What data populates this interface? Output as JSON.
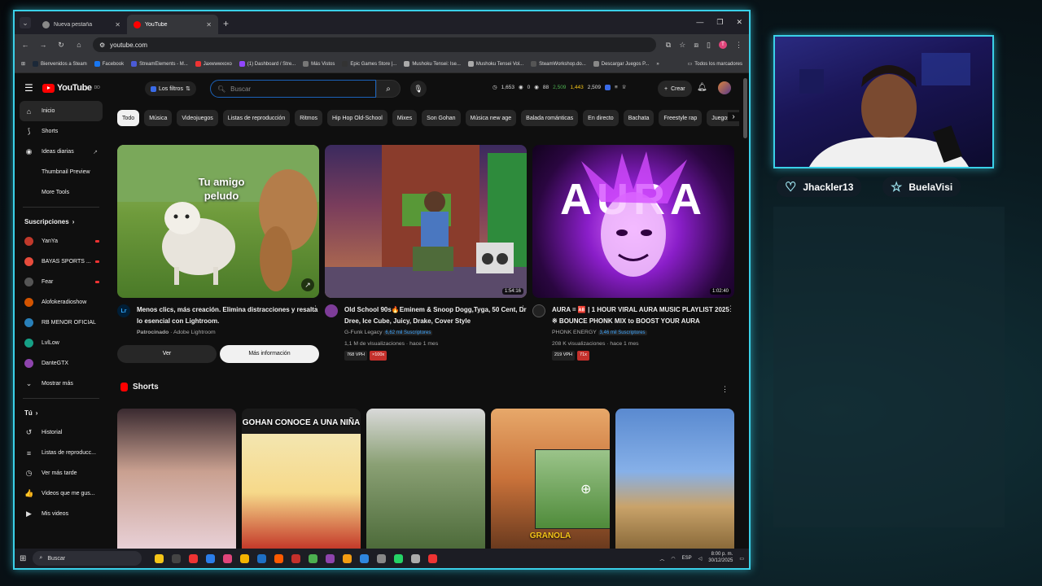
{
  "browser": {
    "tabs": [
      {
        "title": "Nueva pestaña",
        "active": false,
        "favicon_color": "#888888"
      },
      {
        "title": "YouTube",
        "active": true,
        "favicon_color": "#ff0000"
      }
    ],
    "address": "youtube.com",
    "bookmarks": [
      {
        "label": "Bienvenidos a Steam",
        "color": "#1b2838"
      },
      {
        "label": "Facebook",
        "color": "#1877f2"
      },
      {
        "label": "StreamElements - M...",
        "color": "#4b5bd6"
      },
      {
        "label": "Jaxwwwxoxo",
        "color": "#e33"
      },
      {
        "label": "(1) Dashboard / Stre...",
        "color": "#9146ff"
      },
      {
        "label": "Más Vistos",
        "color": "#777"
      },
      {
        "label": "Epic Games Store |...",
        "color": "#333"
      },
      {
        "label": "Mushoku Tensei: Ise...",
        "color": "#aaa"
      },
      {
        "label": "Mushoku Tensei Vol...",
        "color": "#aaa"
      },
      {
        "label": "SteamWorkshop.do...",
        "color": "#555"
      },
      {
        "label": "Descargar Juegos P...",
        "color": "#888"
      }
    ],
    "bookmarks_right": "Todos los marcadores"
  },
  "youtube": {
    "logo": "YouTube",
    "logo_region": "DO",
    "filters_label": "Los filtros",
    "search_placeholder": "Buscar",
    "stats": [
      "1,653",
      "0",
      "88",
      "2,509",
      "1,443",
      "2,509"
    ],
    "create_label": "Crear",
    "sidebar_main": [
      {
        "label": "Inicio",
        "icon": "home-icon",
        "glyph": "⌂",
        "active": true
      },
      {
        "label": "Shorts",
        "icon": "shorts-icon",
        "glyph": "⟆"
      },
      {
        "label": "Ideas diarias",
        "icon": "ideas-icon",
        "glyph": "◉",
        "ext": "↗"
      },
      {
        "label": "Thumbnail Preview",
        "icon": "thumbnail-icon",
        "glyph": " "
      },
      {
        "label": "More Tools",
        "icon": "tools-icon",
        "glyph": " "
      }
    ],
    "subscriptions_heading": "Suscripciones",
    "subscriptions": [
      {
        "label": "YanYa",
        "color": "#c0392b",
        "live": true
      },
      {
        "label": "BAYAS SPORTS ...",
        "color": "#e74c3c",
        "live": true
      },
      {
        "label": "Fear",
        "color": "#555",
        "live": true
      },
      {
        "label": "Alofokeradioshow",
        "color": "#d35400",
        "live": false
      },
      {
        "label": "RB MENOR OFICIAL",
        "color": "#2980b9",
        "live": false
      },
      {
        "label": "LvlLow",
        "color": "#16a085",
        "live": false
      },
      {
        "label": "DanteGTX",
        "color": "#8e44ad",
        "live": false
      }
    ],
    "show_more": "Mostrar más",
    "you_heading": "Tú",
    "you_items": [
      {
        "label": "Historial",
        "glyph": "↺"
      },
      {
        "label": "Listas de reproducc...",
        "glyph": "≡"
      },
      {
        "label": "Ver más tarde",
        "glyph": "◷"
      },
      {
        "label": "Videos que me gus...",
        "glyph": "👍"
      },
      {
        "label": "Mis videos",
        "glyph": "▶"
      }
    ],
    "chips": [
      "Todo",
      "Música",
      "Videojuegos",
      "Listas de reproducción",
      "Ritmos",
      "Hip Hop Old-School",
      "Mixes",
      "Son Gohan",
      "Música new age",
      "Balada románticas",
      "En directo",
      "Bachata",
      "Freestyle rap",
      "Juegos de acción y av"
    ],
    "videos": [
      {
        "thumb_text": "Tu amigo peludo",
        "title": "Menos clics, más creación. Elimina distracciones y resalta lo esencial con Lightroom.",
        "sponsored": "Patrocinado",
        "channel": "Adobe Lightroom",
        "channel_color": "#001e36",
        "ad_buttons": [
          "Ver",
          "Más información"
        ]
      },
      {
        "duration": "1:54:16",
        "title": "Old School 90s🔥Eminem & Snoop Dogg,Tyga, 50 Cent, Dr Dree, Ice Cube, Juicy, Drake, Cover Style",
        "channel": "G-Funk Legacy",
        "subs": "6,62 mil Suscriptores",
        "views": "1,1 M de visualizaciones · hace 1 mes",
        "tags": [
          "768 VPH",
          "×100x"
        ],
        "channel_color": "#7d3c98"
      },
      {
        "duration": "1:02:40",
        "thumb_text": "AURA",
        "title": "AURA = 🆎 | 1 HOUR VIRAL AURA MUSIC PLAYLIST 2025 ※ BOUNCE PHONK MIX to BOOST YOUR AURA",
        "channel": "PHONK ENERGY",
        "subs": "3,46 mil Suscriptores",
        "views": "208 K visualizaciones · hace 1 mes",
        "tags": [
          "219 VPH",
          "71x"
        ],
        "channel_color": "#111"
      }
    ],
    "shorts_heading": "Shorts",
    "shorts": [
      {
        "caption": ""
      },
      {
        "caption": "GOHAN CONOCE A UNA NIÑA"
      },
      {
        "caption": ""
      },
      {
        "caption": "GRANOLA"
      },
      {
        "caption": ""
      }
    ]
  },
  "taskbar": {
    "search": "Buscar",
    "lang": "ESP",
    "time": "8:00 p. m.",
    "date": "30/12/2025"
  },
  "stream": {
    "names": [
      "Jhackler13",
      "BuelaVisi"
    ]
  }
}
